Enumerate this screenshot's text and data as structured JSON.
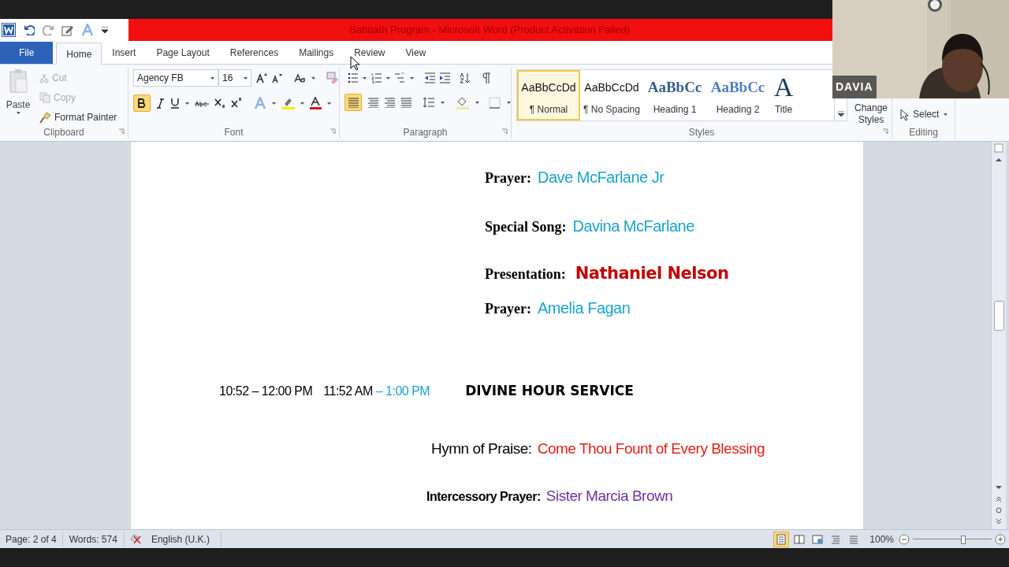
{
  "window": {
    "title": "Sabbath Program  -  Microsoft Word (Product Activation Failed)"
  },
  "tabs": [
    {
      "label": "File",
      "kind": "file",
      "selected": false
    },
    {
      "label": "Home",
      "kind": "tab",
      "selected": true
    },
    {
      "label": "Insert",
      "kind": "tab",
      "selected": false
    },
    {
      "label": "Page Layout",
      "kind": "tab",
      "selected": false
    },
    {
      "label": "References",
      "kind": "tab",
      "selected": false
    },
    {
      "label": "Mailings",
      "kind": "tab",
      "selected": false
    },
    {
      "label": "Review",
      "kind": "tab",
      "selected": false
    },
    {
      "label": "View",
      "kind": "tab",
      "selected": false
    }
  ],
  "clipboard": {
    "paste": "Paste",
    "cut": "Cut",
    "copy": "Copy",
    "format_painter": "Format Painter",
    "group": "Clipboard"
  },
  "font": {
    "name": "Agency FB",
    "size": "16",
    "group": "Font",
    "bold_on": true
  },
  "paragraph": {
    "group": "Paragraph",
    "align_left_on": true
  },
  "styles": {
    "group": "Styles",
    "items": [
      {
        "sample": "AaBbCcDd",
        "label": "¶ Normal",
        "kind": "plain",
        "selected": true
      },
      {
        "sample": "AaBbCcDd",
        "label": "¶ No Spacing",
        "kind": "plain",
        "selected": false
      },
      {
        "sample": "AaBbCc",
        "label": "Heading 1",
        "kind": "heading1",
        "selected": false
      },
      {
        "sample": "AaBbCc",
        "label": "Heading 2",
        "kind": "heading2",
        "selected": false
      },
      {
        "sample": "A",
        "label": "Title",
        "kind": "title",
        "selected": false
      }
    ],
    "change_styles": "Change Styles"
  },
  "editing": {
    "select": "Select",
    "group": "Editing"
  },
  "document": {
    "lines": [
      {
        "kind": "serif",
        "label": "Prayer:",
        "value": "Dave McFarlane  Jr",
        "color": "#1ba3cc"
      },
      {
        "kind": "serif",
        "label": "Special Song:",
        "value": "Davina McFarlane",
        "color": "#1ba3cc"
      },
      {
        "kind": "display",
        "label": "Presentation:",
        "value": "Nathaniel Nelson",
        "color": "#c00000"
      },
      {
        "kind": "serif",
        "label": "Prayer:",
        "value": "Amelia  Fagan",
        "color": "#1ba3cc"
      },
      {
        "kind": "time",
        "parts": [
          "10:52 – 12:00 PM",
          "11:52 AM",
          "– 1:00 PM"
        ],
        "heading": "DIVINE HOUR SERVICE"
      },
      {
        "kind": "narrow",
        "label": "Hymn of Praise:",
        "value": "Come Thou Fount  of Every Blessing",
        "color": "#e0201b"
      },
      {
        "kind": "narrow_small",
        "label": "Intercessory  Prayer:",
        "value": "Sister  Marcia  Brown",
        "color": "#7030a0"
      }
    ]
  },
  "status_bar": {
    "page": "Page: 2 of 4",
    "words": "Words: 574",
    "language": "English (U.K.)",
    "zoom": "100%",
    "zoom_slider": {
      "level": 0.65
    },
    "views": [
      {
        "kind": "print",
        "selected": true
      },
      {
        "kind": "reading",
        "selected": false
      },
      {
        "kind": "web",
        "selected": false
      },
      {
        "kind": "outline",
        "selected": false
      },
      {
        "kind": "draft",
        "selected": false
      }
    ]
  },
  "video": {
    "participant": "DAVIA"
  }
}
